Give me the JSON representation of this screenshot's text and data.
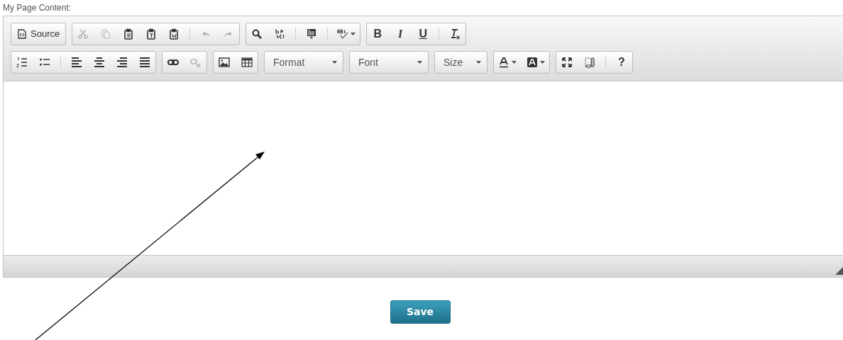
{
  "field_label": "My Page Content:",
  "toolbar": {
    "rows": [
      {
        "groups": [
          {
            "items": [
              {
                "kind": "text",
                "label": "Source",
                "disabled": false
              }
            ]
          },
          {
            "items": [
              {
                "kind": "icon",
                "disabled": true
              },
              {
                "kind": "icon",
                "disabled": true
              },
              {
                "kind": "icon",
                "disabled": false
              },
              {
                "kind": "icon",
                "disabled": false
              },
              {
                "kind": "icon",
                "disabled": false
              },
              {
                "kind": "separator"
              },
              {
                "kind": "icon",
                "disabled": true
              },
              {
                "kind": "icon",
                "disabled": true
              }
            ]
          },
          {
            "items": [
              {
                "kind": "icon",
                "disabled": false
              },
              {
                "kind": "icon",
                "disabled": false
              },
              {
                "kind": "separator"
              },
              {
                "kind": "icon",
                "disabled": false
              },
              {
                "kind": "separator"
              },
              {
                "kind": "menu",
                "disabled": false
              }
            ]
          },
          {
            "items": [
              {
                "kind": "glyph",
                "label": "B",
                "disabled": false
              },
              {
                "kind": "glyph",
                "label": "I",
                "disabled": false
              },
              {
                "kind": "glyph",
                "label": "U",
                "disabled": false
              },
              {
                "kind": "separator"
              },
              {
                "kind": "icon",
                "disabled": false
              }
            ]
          }
        ]
      },
      {
        "groups": [
          {
            "items": [
              {
                "kind": "icon",
                "disabled": false
              },
              {
                "kind": "icon",
                "disabled": false
              },
              {
                "kind": "separator"
              },
              {
                "kind": "icon",
                "disabled": false
              },
              {
                "kind": "icon",
                "disabled": false
              },
              {
                "kind": "icon",
                "disabled": false
              },
              {
                "kind": "icon",
                "disabled": false
              }
            ]
          },
          {
            "items": [
              {
                "kind": "icon",
                "disabled": false
              },
              {
                "kind": "icon",
                "disabled": true
              }
            ]
          },
          {
            "items": [
              {
                "kind": "icon",
                "disabled": false
              },
              {
                "kind": "icon",
                "disabled": false
              }
            ]
          },
          {
            "items": [
              {
                "kind": "dropdown",
                "label": "Format"
              }
            ]
          },
          {
            "items": [
              {
                "kind": "dropdown",
                "label": "Font"
              }
            ]
          },
          {
            "items": [
              {
                "kind": "dropdown",
                "label": "Size"
              }
            ]
          },
          {
            "items": [
              {
                "kind": "menu",
                "disabled": false
              },
              {
                "kind": "menu",
                "disabled": false
              }
            ]
          },
          {
            "items": [
              {
                "kind": "icon",
                "disabled": false
              },
              {
                "kind": "icon",
                "disabled": false
              },
              {
                "kind": "separator"
              },
              {
                "kind": "glyph",
                "label": "?",
                "disabled": false
              }
            ]
          }
        ]
      }
    ]
  },
  "save_button": {
    "label": "Save"
  }
}
